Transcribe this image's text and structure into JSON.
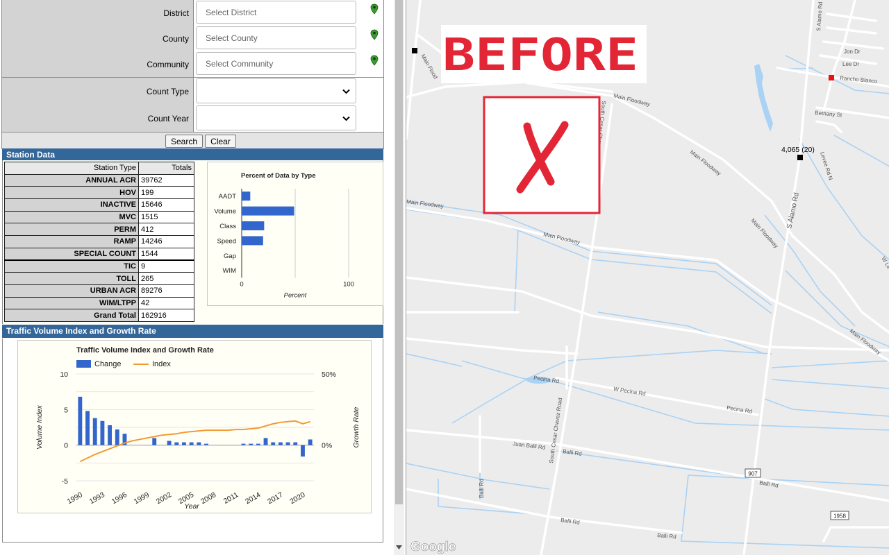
{
  "filters": {
    "district": {
      "label": "District",
      "placeholder": "Select District"
    },
    "county": {
      "label": "County",
      "placeholder": "Select County"
    },
    "community": {
      "label": "Community",
      "placeholder": "Select Community"
    },
    "count_type": {
      "label": "Count Type",
      "value": ""
    },
    "count_year": {
      "label": "Count Year",
      "value": ""
    }
  },
  "buttons": {
    "search": "Search",
    "clear": "Clear"
  },
  "station_data": {
    "header": "Station Data",
    "columns": [
      "Station Type",
      "Totals"
    ],
    "rows": [
      {
        "type": "ANNUAL ACR",
        "total": "39762"
      },
      {
        "type": "HOV",
        "total": "199"
      },
      {
        "type": "INACTIVE",
        "total": "15646"
      },
      {
        "type": "MVC",
        "total": "1515"
      },
      {
        "type": "PERM",
        "total": "412"
      },
      {
        "type": "RAMP",
        "total": "14246"
      },
      {
        "type": "SPECIAL COUNT",
        "total": "1544"
      },
      {
        "type": "TIC",
        "total": "9"
      },
      {
        "type": "TOLL",
        "total": "265"
      },
      {
        "type": "URBAN ACR",
        "total": "89276"
      },
      {
        "type": "WIM/LTPP",
        "total": "42"
      },
      {
        "type": "Grand Total",
        "total": "162916"
      }
    ]
  },
  "traffic_section": {
    "header": "Traffic Volume Index and Growth Rate"
  },
  "chart_data": [
    {
      "type": "bar",
      "orientation": "horizontal",
      "title": "Percent of Data by Type",
      "xlabel": "Percent",
      "ylabel": "",
      "xlim": [
        0,
        100
      ],
      "x_ticks": [
        "0",
        "100"
      ],
      "categories": [
        "AADT",
        "Volume",
        "Class",
        "Speed",
        "Gap",
        "WIM"
      ],
      "values": [
        8,
        49,
        21,
        20,
        0,
        0
      ],
      "grid": true,
      "color": "#3366cc"
    },
    {
      "type": "bar+line",
      "title": "Traffic Volume Index and Growth Rate",
      "xlabel": "Year",
      "ylabel": "Volume Index",
      "y2label": "Growth Rate",
      "ylim": [
        -5,
        10
      ],
      "y2lim": [
        "-50%",
        "50%"
      ],
      "y_ticks": [
        "10",
        "5",
        "0",
        "-5"
      ],
      "y2_ticks": [
        "50%",
        "0%",
        "-50%"
      ],
      "x_ticks": [
        "1990",
        "1993",
        "1996",
        "1999",
        "2002",
        "2005",
        "2008",
        "2011",
        "2014",
        "2017",
        "2020"
      ],
      "legend_position": "top-left",
      "x": [
        1990,
        1991,
        1992,
        1993,
        1994,
        1995,
        1996,
        1997,
        1998,
        1999,
        2000,
        2001,
        2002,
        2003,
        2004,
        2005,
        2006,
        2007,
        2008,
        2009,
        2010,
        2011,
        2012,
        2013,
        2014,
        2015,
        2016,
        2017,
        2018,
        2019,
        2020,
        2021
      ],
      "series": [
        {
          "name": "Change",
          "type": "bar",
          "color": "#3366cc",
          "values": [
            34,
            24,
            19,
            17,
            14,
            11,
            8,
            0,
            0,
            0,
            5,
            0,
            3,
            2,
            2,
            2,
            2,
            1,
            0,
            0,
            0,
            0,
            1,
            1,
            1,
            5,
            2,
            2,
            2,
            2,
            -8,
            4
          ]
        },
        {
          "name": "Index",
          "type": "line",
          "color": "#f29a34",
          "values": [
            -2.3,
            -1.8,
            -1.3,
            -0.9,
            -0.5,
            -0.1,
            0.3,
            0.6,
            0.8,
            1.0,
            1.2,
            1.4,
            1.5,
            1.6,
            1.8,
            1.9,
            2.0,
            2.1,
            2.1,
            2.1,
            2.1,
            2.2,
            2.2,
            2.3,
            2.4,
            2.7,
            3.0,
            3.2,
            3.3,
            3.4,
            3.0,
            3.3
          ]
        }
      ]
    }
  ],
  "map": {
    "stamp_text": "BEFORE",
    "stamp_color": "#e32636",
    "count_label": "4,065 (20)",
    "attribution": "Google",
    "shields": [
      "907",
      "1958"
    ],
    "roads": [
      "S Alamo Rd",
      "Jon Dr",
      "Lee Dr",
      "Rancho Blanco",
      "Bethany St",
      "Levee Rd N",
      "Main Floodway",
      "South Cesar Chavez Road",
      "W Pecina Rd",
      "Pecina Rd",
      "Pecina Rd",
      "Juan Balli Rd",
      "Balli Rd",
      "Balli Rd",
      "Balli Rd",
      "Balli Rd",
      "Main Flood",
      "W Le"
    ]
  }
}
